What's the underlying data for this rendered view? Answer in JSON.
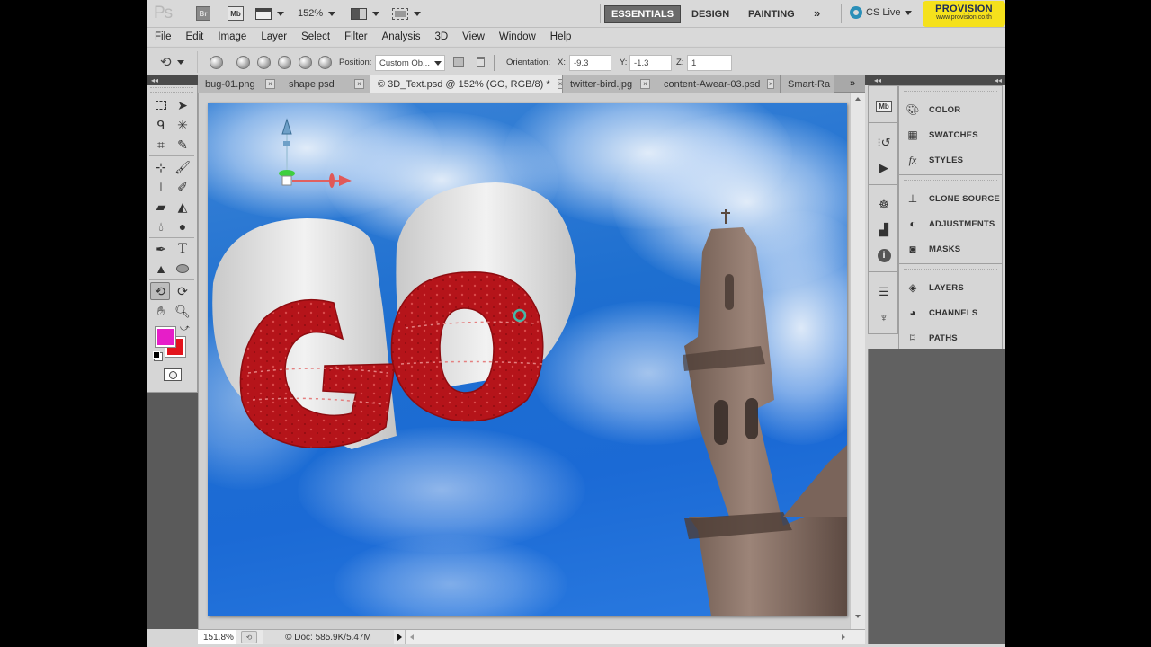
{
  "appbar": {
    "app_logo": "Ps",
    "bridge_label": "Br",
    "minibridge_label": "Mb",
    "zoom_level": "152%",
    "workspaces": [
      {
        "label": "ESSENTIALS",
        "active": true
      },
      {
        "label": "DESIGN",
        "active": false
      },
      {
        "label": "PAINTING",
        "active": false
      }
    ],
    "more_workspaces": "»",
    "cs_live": "CS Live",
    "brand": {
      "title": "PROVISION",
      "url": "www.provision.co.th",
      "color": "#f5e11c"
    }
  },
  "menu": [
    "File",
    "Edit",
    "Image",
    "Layer",
    "Select",
    "Filter",
    "Analysis",
    "3D",
    "View",
    "Window",
    "Help"
  ],
  "options": {
    "position_label": "Position:",
    "position_value": "Custom Ob...",
    "orientation_label": "Orientation:",
    "x_label": "X:",
    "x_value": "-9.3",
    "y_label": "Y:",
    "y_value": "-1.3",
    "z_label": "Z:",
    "z_value": "1"
  },
  "tabs": [
    {
      "label": "bug-01.png",
      "active": false,
      "closable": true
    },
    {
      "label": "shape.psd",
      "active": false,
      "closable": true
    },
    {
      "label": "© 3D_Text.psd @ 152% (GO, RGB/8) *",
      "active": true,
      "closable": true
    },
    {
      "label": "twitter-bird.jpg",
      "active": false,
      "closable": true
    },
    {
      "label": "content-Awear-03.psd",
      "active": false,
      "closable": true
    },
    {
      "label": "Smart-Ra",
      "active": false,
      "closable": false
    }
  ],
  "tabs_overflow": "»",
  "canvas": {
    "text_3d": "GO",
    "sky_color": "#1e6fd0",
    "text_color": "#c2161c"
  },
  "colors": {
    "foreground": "#e61ec8",
    "background": "#e3141c"
  },
  "status": {
    "zoom": "151.8%",
    "doc_info": "© Doc: 585.9K/5.47M"
  },
  "panels": {
    "groups": [
      [
        {
          "icon": "color-icon",
          "label": "COLOR"
        },
        {
          "icon": "swatches-icon",
          "label": "SWATCHES"
        },
        {
          "icon": "styles-icon",
          "label": "STYLES"
        }
      ],
      [
        {
          "icon": "clone-source-icon",
          "label": "CLONE SOURCE"
        },
        {
          "icon": "adjustments-icon",
          "label": "ADJUSTMENTS"
        },
        {
          "icon": "masks-icon",
          "label": "MASKS"
        }
      ],
      [
        {
          "icon": "layers-icon",
          "label": "LAYERS"
        },
        {
          "icon": "channels-icon",
          "label": "CHANNELS"
        },
        {
          "icon": "paths-icon",
          "label": "PATHS"
        }
      ]
    ],
    "collapse_glyph": "◂◂"
  }
}
